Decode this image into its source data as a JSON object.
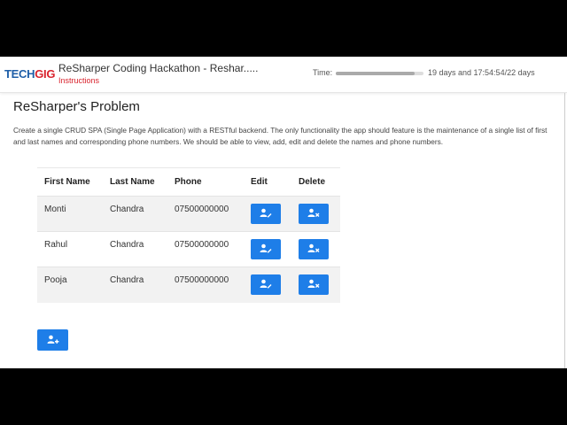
{
  "header": {
    "logo_tech": "TECH",
    "logo_gig": "GIG",
    "title": "ReSharper Coding Hackathon - Reshar.....",
    "subtitle": "Instructions",
    "time_label": "Time:",
    "time_value": "19 days and 17:54:54/22 days",
    "time_progress": 0.9
  },
  "problem": {
    "heading": "ReSharper's Problem",
    "description": "Create a single CRUD SPA (Single Page Application) with a RESTful backend. The only functionality the app should feature is the maintenance of a single list of first and last names and corresponding phone numbers. We should be able to view, add, edit and delete the names and phone numbers."
  },
  "table": {
    "headers": [
      "First Name",
      "Last Name",
      "Phone",
      "Edit",
      "Delete"
    ],
    "rows": [
      {
        "first": "Monti",
        "last": "Chandra",
        "phone": "07500000000"
      },
      {
        "first": "Rahul",
        "last": "Chandra",
        "phone": "07500000000"
      },
      {
        "first": "Pooja",
        "last": "Chandra",
        "phone": "07500000000"
      }
    ]
  },
  "icons": {
    "edit": "user-edit-icon",
    "delete": "user-remove-icon",
    "add": "user-add-icon"
  },
  "colors": {
    "button_blue": "#1e7ee8",
    "brand_blue": "#1f5fa8",
    "brand_red": "#d9232d"
  }
}
